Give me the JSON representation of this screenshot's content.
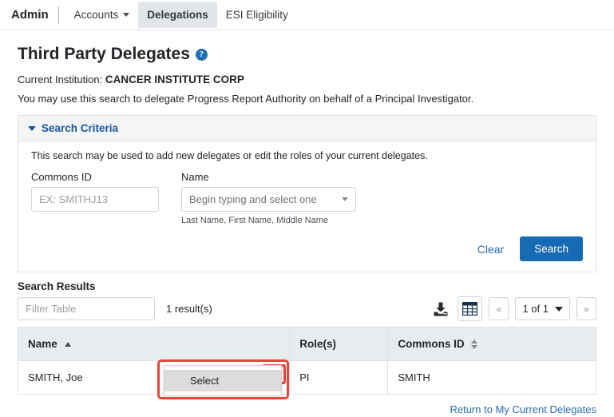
{
  "nav": {
    "brand": "Admin",
    "items": [
      {
        "label": "Accounts",
        "has_caret": true,
        "active": false
      },
      {
        "label": "Delegations",
        "has_caret": false,
        "active": true
      },
      {
        "label": "ESI Eligibility",
        "has_caret": false,
        "active": false
      }
    ]
  },
  "page": {
    "title": "Third Party Delegates",
    "help_icon": "help-circle-icon",
    "institution_label": "Current Institution:",
    "institution_value": "CANCER INSTITUTE CORP",
    "description": "You may use this search to delegate Progress Report Authority on behalf of a Principal Investigator."
  },
  "search_panel": {
    "header": "Search Criteria",
    "collapse_icon": "triangle-down-icon",
    "body_text": "This search may be used to add new delegates or edit the roles of your current delegates.",
    "commons_id": {
      "label": "Commons ID",
      "placeholder": "EX: SMITHJ13",
      "value": ""
    },
    "name": {
      "label": "Name",
      "placeholder": "Begin typing and select one",
      "value": "Begin typing and select one",
      "hint": "Last Name, First Name, Middle Name",
      "caret_icon": "caret-down-icon"
    },
    "clear_label": "Clear",
    "search_label": "Search"
  },
  "results": {
    "title": "Search Results",
    "filter_placeholder": "Filter Table",
    "filter_value": "",
    "count_text": "1 result(s)",
    "toolbar": {
      "download_icon": "download-icon",
      "grid_icon": "table-grid-icon",
      "prev_label": "«",
      "next_label": "»",
      "page_value": "1 of 1",
      "page_caret": "chevron-down-icon"
    },
    "columns": [
      {
        "label": "Name",
        "sort": "asc"
      },
      {
        "label": "Role(s)",
        "sort": "none"
      },
      {
        "label": "Commons ID",
        "sort": "both"
      }
    ],
    "rows": [
      {
        "name": "SMITH, Joe",
        "roles": "PI",
        "commons_id": "SMITH"
      }
    ],
    "row_menu_icon": "ellipsis-icon"
  },
  "dropdown": {
    "items": [
      {
        "label": "Select",
        "highlighted": true
      }
    ]
  },
  "footer": {
    "return_link": "Return to My Current Delegates"
  },
  "colors": {
    "primary_blue": "#176ab4",
    "link_blue": "#2b6cb0",
    "header_blue": "#18559e",
    "annotation_red": "#e8463a",
    "table_header_bg": "#e9ecef",
    "panel_head_bg": "#f4f5f7"
  }
}
